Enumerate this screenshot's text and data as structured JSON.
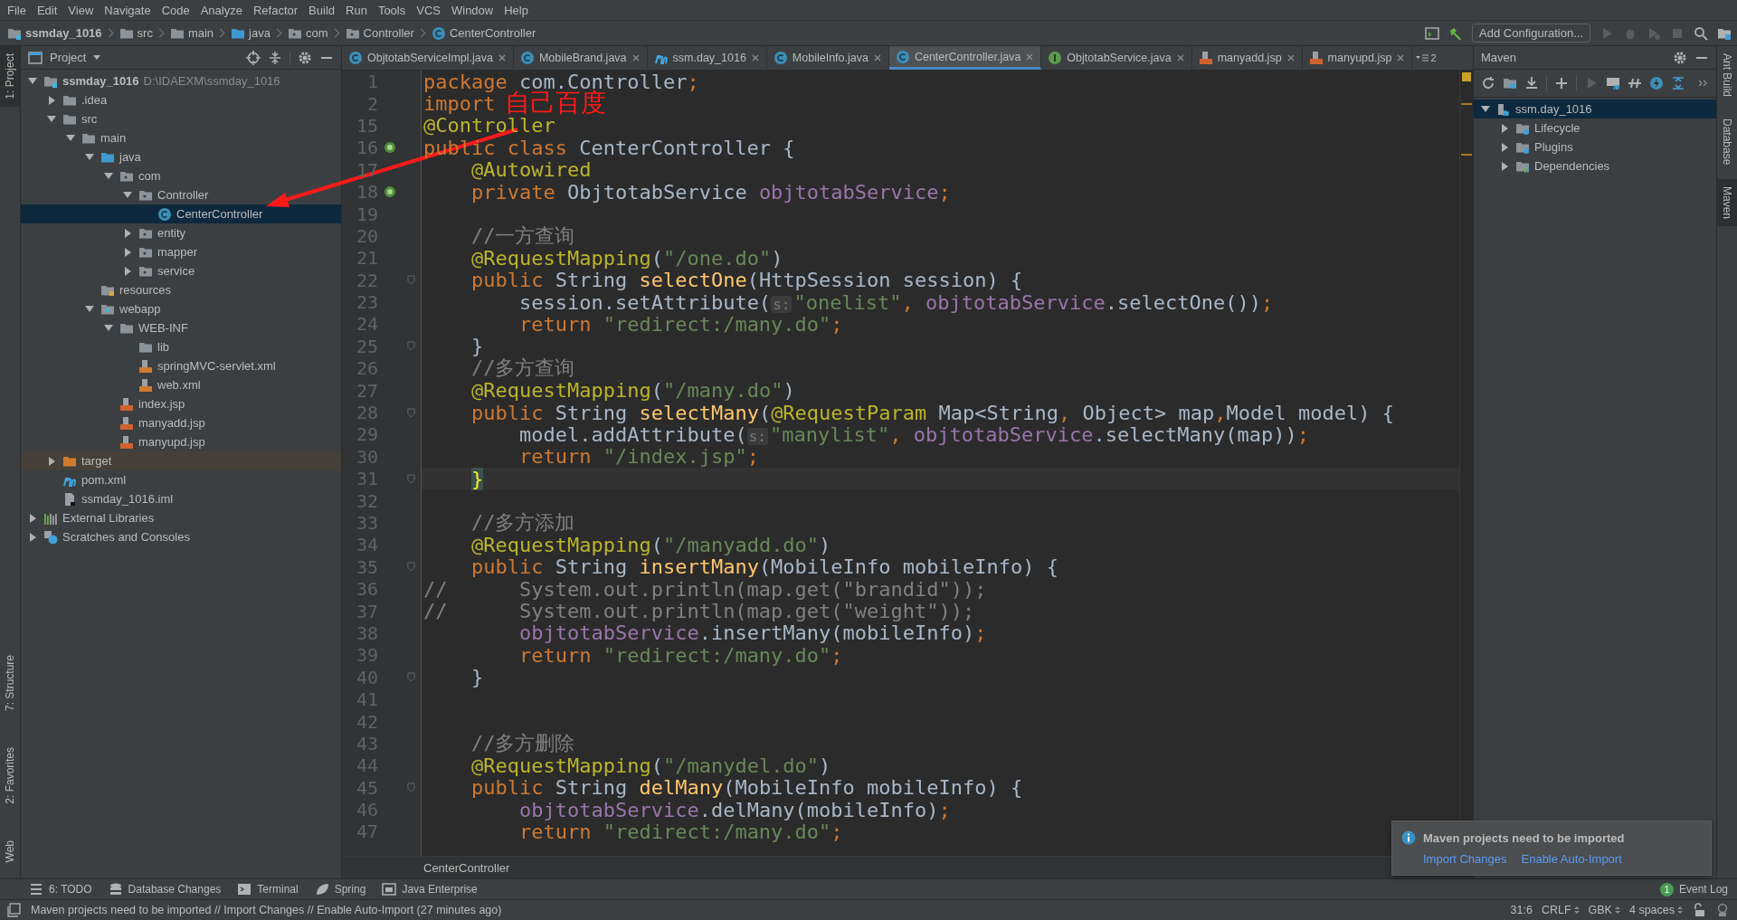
{
  "menu": [
    "File",
    "Edit",
    "View",
    "Navigate",
    "Code",
    "Analyze",
    "Refactor",
    "Build",
    "Run",
    "Tools",
    "VCS",
    "Window",
    "Help"
  ],
  "breadcrumb": [
    {
      "label": "ssmday_1016",
      "kind": "module"
    },
    {
      "label": "src",
      "kind": "folder"
    },
    {
      "label": "main",
      "kind": "folder"
    },
    {
      "label": "java",
      "kind": "src-folder"
    },
    {
      "label": "com",
      "kind": "package"
    },
    {
      "label": "Controller",
      "kind": "package"
    },
    {
      "label": "CenterController",
      "kind": "class"
    }
  ],
  "run_config": {
    "label": "Add Configuration..."
  },
  "left_stripe": {
    "top": [
      {
        "label": "1: Project",
        "selected": true
      }
    ],
    "bottom": [
      {
        "label": "7: Structure",
        "selected": false
      },
      {
        "label": "2: Favorites",
        "selected": false
      },
      {
        "label": "Web",
        "selected": false
      }
    ]
  },
  "right_stripe": [
    {
      "label": "Ant Build",
      "selected": false
    },
    {
      "label": "Database",
      "selected": false
    },
    {
      "label": "Maven",
      "selected": true
    }
  ],
  "project": {
    "title": "Project",
    "tree": [
      {
        "label": "ssmday_1016",
        "path": "D:\\IDAEXM\\ssmday_1016",
        "kind": "module",
        "expanded": true,
        "selected": false,
        "children": [
          {
            "label": ".idea",
            "kind": "folder",
            "expanded": false,
            "selected": false
          },
          {
            "label": "src",
            "kind": "folder",
            "expanded": true,
            "selected": false,
            "children": [
              {
                "label": "main",
                "kind": "folder",
                "expanded": true,
                "selected": false,
                "children": [
                  {
                    "label": "java",
                    "kind": "src-folder",
                    "expanded": true,
                    "selected": false,
                    "children": [
                      {
                        "label": "com",
                        "kind": "package",
                        "expanded": true,
                        "selected": false,
                        "children": [
                          {
                            "label": "Controller",
                            "kind": "package",
                            "expanded": true,
                            "selected": false,
                            "children": [
                              {
                                "label": "CenterController",
                                "kind": "class",
                                "selected": true
                              }
                            ]
                          },
                          {
                            "label": "entity",
                            "kind": "package",
                            "expanded": false,
                            "selected": false
                          },
                          {
                            "label": "mapper",
                            "kind": "package",
                            "expanded": false,
                            "selected": false
                          },
                          {
                            "label": "service",
                            "kind": "package",
                            "expanded": false,
                            "selected": false
                          }
                        ]
                      }
                    ]
                  },
                  {
                    "label": "resources",
                    "kind": "resources",
                    "selected": false
                  },
                  {
                    "label": "webapp",
                    "kind": "web",
                    "expanded": true,
                    "selected": false,
                    "children": [
                      {
                        "label": "WEB-INF",
                        "kind": "folder",
                        "expanded": true,
                        "selected": false,
                        "children": [
                          {
                            "label": "lib",
                            "kind": "folder",
                            "selected": false
                          },
                          {
                            "label": "springMVC-servlet.xml",
                            "kind": "xml",
                            "selected": false
                          },
                          {
                            "label": "web.xml",
                            "kind": "xml",
                            "selected": false
                          }
                        ]
                      },
                      {
                        "label": "index.jsp",
                        "kind": "jsp",
                        "selected": false
                      },
                      {
                        "label": "manyadd.jsp",
                        "kind": "jsp",
                        "selected": false
                      },
                      {
                        "label": "manyupd.jsp",
                        "kind": "jsp",
                        "selected": false
                      }
                    ]
                  }
                ]
              }
            ]
          },
          {
            "label": "target",
            "kind": "target",
            "expanded": false,
            "selected": false
          },
          {
            "label": "pom.xml",
            "kind": "maven",
            "selected": false
          },
          {
            "label": "ssmday_1016.iml",
            "kind": "iml",
            "selected": false
          }
        ]
      },
      {
        "label": "External Libraries",
        "kind": "libs",
        "expanded": false,
        "selected": false
      },
      {
        "label": "Scratches and Consoles",
        "kind": "scratches",
        "expanded": false,
        "selected": false
      }
    ]
  },
  "tabs": [
    {
      "label": "ObjtotabServiceImpl.java",
      "kind": "class",
      "selected": false
    },
    {
      "label": "MobileBrand.java",
      "kind": "class",
      "selected": false
    },
    {
      "label": "ssm.day_1016",
      "kind": "maven",
      "selected": false
    },
    {
      "label": "MobileInfo.java",
      "kind": "class",
      "selected": false
    },
    {
      "label": "CenterController.java",
      "kind": "class",
      "selected": true
    },
    {
      "label": "ObjtotabService.java",
      "kind": "interface",
      "selected": false
    },
    {
      "label": "manyadd.jsp",
      "kind": "jsp",
      "selected": false
    },
    {
      "label": "manyupd.jsp",
      "kind": "jsp",
      "selected": false
    }
  ],
  "hidden_tabs": "2",
  "code": [
    {
      "n": "1",
      "tokens": [
        {
          "t": "package",
          "kind": "kw"
        },
        {
          "t": " com.Controller",
          "kind": "p"
        },
        {
          "t": ";",
          "kind": "kw"
        }
      ]
    },
    {
      "n": "2",
      "tokens": [
        {
          "t": "import ",
          "kind": "kw"
        }
      ]
    },
    {
      "n": "15",
      "tokens": [
        {
          "t": "@Controller",
          "kind": "ann"
        }
      ]
    },
    {
      "n": "16",
      "gutter": {
        "kind": "bean"
      },
      "tokens": [
        {
          "t": "public class ",
          "kind": "kw"
        },
        {
          "t": "CenterController {",
          "kind": "p"
        }
      ]
    },
    {
      "n": "17",
      "tokens": [
        {
          "t": "    @Autowired",
          "kind": "ann"
        }
      ]
    },
    {
      "n": "18",
      "gutter": {
        "kind": "bean"
      },
      "tokens": [
        {
          "t": "    private ",
          "kind": "kw"
        },
        {
          "t": "ObjtotabService ",
          "kind": "p"
        },
        {
          "t": "objtotabService",
          "kind": "field"
        },
        {
          "t": ";",
          "kind": "kw"
        }
      ]
    },
    {
      "n": "19"
    },
    {
      "n": "20",
      "tokens": [
        {
          "t": "    //一方查询",
          "kind": "com"
        }
      ]
    },
    {
      "n": "21",
      "tokens": [
        {
          "t": "    @RequestMapping",
          "kind": "ann"
        },
        {
          "t": "(",
          "kind": "p"
        },
        {
          "t": "\"/one.do\"",
          "kind": "str"
        },
        {
          "t": ")",
          "kind": "p"
        }
      ]
    },
    {
      "n": "22",
      "gutter": {
        "kind": "fold"
      },
      "tokens": [
        {
          "t": "    public ",
          "kind": "kw"
        },
        {
          "t": "String ",
          "kind": "p"
        },
        {
          "t": "selectOne",
          "kind": "fn"
        },
        {
          "t": "(HttpSession session) {",
          "kind": "p"
        }
      ]
    },
    {
      "n": "23",
      "tokens": [
        {
          "t": "        session.setAttribute(",
          "kind": "p"
        },
        {
          "t": "s:",
          "kind": "hint"
        },
        {
          "t": "\"onelist\"",
          "kind": "str"
        },
        {
          "t": ", ",
          "kind": "kw"
        },
        {
          "t": "objtotabService",
          "kind": "field"
        },
        {
          "t": ".selectOne())",
          "kind": "p"
        },
        {
          "t": ";",
          "kind": "kw"
        }
      ]
    },
    {
      "n": "24",
      "tokens": [
        {
          "t": "        return ",
          "kind": "kw"
        },
        {
          "t": "\"redirect:/many.do\"",
          "kind": "str"
        },
        {
          "t": ";",
          "kind": "kw"
        }
      ]
    },
    {
      "n": "25",
      "gutter": {
        "kind": "fold"
      },
      "tokens": [
        {
          "t": "    }",
          "kind": "p"
        }
      ]
    },
    {
      "n": "26",
      "tokens": [
        {
          "t": "    //多方查询",
          "kind": "com"
        }
      ]
    },
    {
      "n": "27",
      "tokens": [
        {
          "t": "    @RequestMapping",
          "kind": "ann"
        },
        {
          "t": "(",
          "kind": "p"
        },
        {
          "t": "\"/many.do\"",
          "kind": "str"
        },
        {
          "t": ")",
          "kind": "p"
        }
      ]
    },
    {
      "n": "28",
      "gutter": {
        "kind": "fold"
      },
      "tokens": [
        {
          "t": "    public ",
          "kind": "kw"
        },
        {
          "t": "String ",
          "kind": "p"
        },
        {
          "t": "selectMany",
          "kind": "fn"
        },
        {
          "t": "(",
          "kind": "p"
        },
        {
          "t": "@RequestParam ",
          "kind": "ann"
        },
        {
          "t": "Map<String",
          "kind": "p"
        },
        {
          "t": ", ",
          "kind": "kw"
        },
        {
          "t": "Object> map",
          "kind": "p"
        },
        {
          "t": ",",
          "kind": "kw"
        },
        {
          "t": "Model model) {",
          "kind": "p"
        }
      ]
    },
    {
      "n": "29",
      "tokens": [
        {
          "t": "        model.addAttribute(",
          "kind": "p"
        },
        {
          "t": "s:",
          "kind": "hint"
        },
        {
          "t": "\"manylist\"",
          "kind": "str"
        },
        {
          "t": ", ",
          "kind": "kw"
        },
        {
          "t": "objtotabService",
          "kind": "field"
        },
        {
          "t": ".selectMany(map))",
          "kind": "p"
        },
        {
          "t": ";",
          "kind": "kw"
        }
      ]
    },
    {
      "n": "30",
      "tokens": [
        {
          "t": "        return ",
          "kind": "kw"
        },
        {
          "t": "\"/index.jsp\"",
          "kind": "str"
        },
        {
          "t": ";",
          "kind": "kw"
        }
      ]
    },
    {
      "n": "31",
      "gutter": {
        "kind": "fold"
      },
      "current": true,
      "tokens": [
        {
          "t": "    }",
          "kind": "match"
        }
      ]
    },
    {
      "n": "32"
    },
    {
      "n": "33",
      "tokens": [
        {
          "t": "    //多方添加",
          "kind": "com"
        }
      ]
    },
    {
      "n": "34",
      "tokens": [
        {
          "t": "    @RequestMapping",
          "kind": "ann"
        },
        {
          "t": "(",
          "kind": "p"
        },
        {
          "t": "\"/manyadd.do\"",
          "kind": "str"
        },
        {
          "t": ")",
          "kind": "p"
        }
      ]
    },
    {
      "n": "35",
      "gutter": {
        "kind": "fold"
      },
      "tokens": [
        {
          "t": "    public ",
          "kind": "kw"
        },
        {
          "t": "String ",
          "kind": "p"
        },
        {
          "t": "insertMany",
          "kind": "fn"
        },
        {
          "t": "(MobileInfo mobileInfo) {",
          "kind": "p"
        }
      ]
    },
    {
      "n": "36",
      "tokens": [
        {
          "t": "//      System.out.println(map.get(\"brandid\"));",
          "kind": "com"
        }
      ]
    },
    {
      "n": "37",
      "tokens": [
        {
          "t": "//      System.out.println(map.get(\"weight\"));",
          "kind": "com"
        }
      ]
    },
    {
      "n": "38",
      "tokens": [
        {
          "t": "        objtotabService",
          "kind": "field"
        },
        {
          "t": ".insertMany(mobileInfo)",
          "kind": "p"
        },
        {
          "t": ";",
          "kind": "kw"
        }
      ]
    },
    {
      "n": "39",
      "tokens": [
        {
          "t": "        return ",
          "kind": "kw"
        },
        {
          "t": "\"redirect:/many.do\"",
          "kind": "str"
        },
        {
          "t": ";",
          "kind": "kw"
        }
      ]
    },
    {
      "n": "40",
      "gutter": {
        "kind": "fold"
      },
      "tokens": [
        {
          "t": "    }",
          "kind": "p"
        }
      ]
    },
    {
      "n": "41"
    },
    {
      "n": "42"
    },
    {
      "n": "43",
      "tokens": [
        {
          "t": "    //多方删除",
          "kind": "com"
        }
      ]
    },
    {
      "n": "44",
      "tokens": [
        {
          "t": "    @RequestMapping",
          "kind": "ann"
        },
        {
          "t": "(",
          "kind": "p"
        },
        {
          "t": "\"/manydel.do\"",
          "kind": "str"
        },
        {
          "t": ")",
          "kind": "p"
        }
      ]
    },
    {
      "n": "45",
      "gutter": {
        "kind": "fold"
      },
      "tokens": [
        {
          "t": "    public ",
          "kind": "kw"
        },
        {
          "t": "String ",
          "kind": "p"
        },
        {
          "t": "delMany",
          "kind": "fn"
        },
        {
          "t": "(MobileInfo mobileInfo) {",
          "kind": "p"
        }
      ]
    },
    {
      "n": "46",
      "tokens": [
        {
          "t": "        objtotabService",
          "kind": "field"
        },
        {
          "t": ".delMany(mobileInfo)",
          "kind": "p"
        },
        {
          "t": ";",
          "kind": "kw"
        }
      ]
    },
    {
      "n": "47",
      "tokens": [
        {
          "t": "        return ",
          "kind": "kw"
        },
        {
          "t": "\"redirect:/many.do\"",
          "kind": "str"
        },
        {
          "t": ";",
          "kind": "kw"
        }
      ]
    }
  ],
  "editor_breadcrumb": "CenterController",
  "maven": {
    "title": "Maven",
    "tree": [
      {
        "label": "ssm.day_1016",
        "kind": "maven-module",
        "expanded": true,
        "selected": true,
        "children": [
          {
            "label": "Lifecycle",
            "kind": "gear-folder",
            "expanded": false,
            "selected": false
          },
          {
            "label": "Plugins",
            "kind": "gear-folder",
            "expanded": false,
            "selected": false
          },
          {
            "label": "Dependencies",
            "kind": "deps",
            "expanded": false,
            "selected": false
          }
        ]
      }
    ]
  },
  "annotation": {
    "text": "自己百度"
  },
  "notification": {
    "title": "Maven projects need to be imported",
    "links": [
      "Import Changes",
      "Enable Auto-Import"
    ]
  },
  "tool_tabs": [
    {
      "label": "6: TODO",
      "kind": "todo"
    },
    {
      "label": "Database Changes",
      "kind": "db"
    },
    {
      "label": "Terminal",
      "kind": "terminal"
    },
    {
      "label": "Spring",
      "kind": "spring"
    },
    {
      "label": "Java Enterprise",
      "kind": "javaee"
    }
  ],
  "event_log": {
    "label": "Event Log",
    "count": "1"
  },
  "status": {
    "message": "Maven projects need to be imported // Import Changes // Enable Auto-Import (27 minutes ago)",
    "position": "31:6",
    "line_sep": "CRLF",
    "encoding": "GBK",
    "indent": "4 spaces"
  }
}
